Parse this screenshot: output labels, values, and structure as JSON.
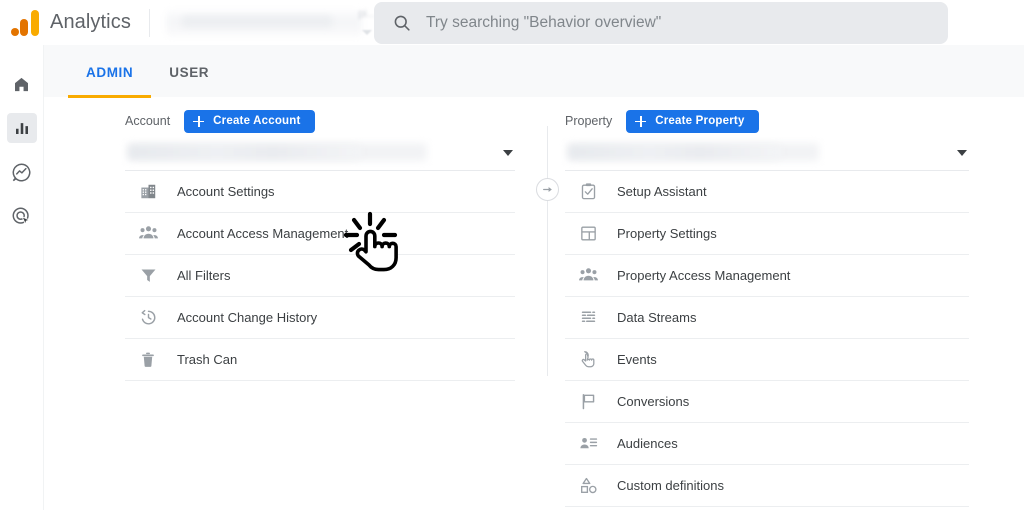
{
  "header": {
    "brand": "Analytics",
    "account_picker": {
      "redacted_label": "pi...",
      "caret_icon": "chevron-down-icon",
      "redacted": true
    },
    "search": {
      "placeholder": "Try searching \"Behavior overview\"",
      "value": "",
      "icon": "search-icon"
    }
  },
  "rail": {
    "items": [
      {
        "name": "home",
        "icon": "home-icon",
        "active": false
      },
      {
        "name": "reports",
        "icon": "bar-chart-icon",
        "active": true
      },
      {
        "name": "explore",
        "icon": "explore-icon",
        "active": false
      },
      {
        "name": "advertising",
        "icon": "target-cursor-icon",
        "active": false
      }
    ]
  },
  "tabs": [
    {
      "label": "ADMIN",
      "active": true
    },
    {
      "label": "USER",
      "active": false
    }
  ],
  "account_column": {
    "label": "Account",
    "create_button": "Create Account",
    "selector": {
      "value": "",
      "redacted": true,
      "caret_icon": "chevron-down-icon"
    },
    "items": [
      {
        "label": "Account Settings",
        "icon": "building-icon"
      },
      {
        "label": "Account Access Management",
        "icon": "people-icon"
      },
      {
        "label": "All Filters",
        "icon": "filter-funnel-icon"
      },
      {
        "label": "Account Change History",
        "icon": "history-clock-icon"
      },
      {
        "label": "Trash Can",
        "icon": "trash-icon"
      }
    ]
  },
  "property_column": {
    "label": "Property",
    "create_button": "Create Property",
    "selector": {
      "value": "",
      "redacted": true,
      "caret_icon": "chevron-down-icon"
    },
    "items": [
      {
        "label": "Setup Assistant",
        "icon": "clipboard-check-icon"
      },
      {
        "label": "Property Settings",
        "icon": "layout-panel-icon"
      },
      {
        "label": "Property Access Management",
        "icon": "people-icon"
      },
      {
        "label": "Data Streams",
        "icon": "data-streams-icon"
      },
      {
        "label": "Events",
        "icon": "tap-hand-icon"
      },
      {
        "label": "Conversions",
        "icon": "flag-icon"
      },
      {
        "label": "Audiences",
        "icon": "person-list-icon"
      },
      {
        "label": "Custom definitions",
        "icon": "shapes-icon"
      }
    ]
  },
  "divider": {
    "collapse_icon": "arrow-right-circle-icon"
  },
  "cursor": {
    "icon": "click-hand-cursor-icon"
  },
  "colors": {
    "brand_blue": "#1a73e8",
    "brand_orange": "#f9ab00",
    "brand_orange_dark": "#e37400",
    "text_primary": "#3c4043",
    "text_secondary": "#5f6368",
    "tabbar_bg": "#f8f9fa",
    "search_bg": "#e8eaed",
    "divider": "#e8eaed"
  }
}
